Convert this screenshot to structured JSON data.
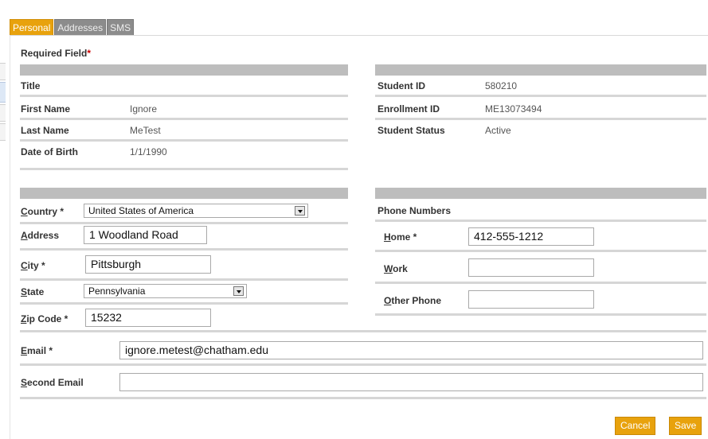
{
  "tabs": [
    "Personal",
    "Addresses",
    "SMS"
  ],
  "required_label": "Required Field",
  "required_star": "*",
  "personal": {
    "title_label": "Title",
    "title_value": "",
    "first_name_label": "First Name",
    "first_name_value": "Ignore",
    "last_name_label": "Last Name",
    "last_name_value": "MeTest",
    "dob_label": "Date of Birth",
    "dob_value": "1/1/1990"
  },
  "student": {
    "id_label": "Student ID",
    "id_value": "580210",
    "enrollment_label": "Enrollment ID",
    "enrollment_value": "ME13073494",
    "status_label": "Student Status",
    "status_value": "Active"
  },
  "address": {
    "country_label": "Country *",
    "country_value": "United States of America",
    "address_label": "Address",
    "address_value": "1 Woodland Road",
    "city_label": "City *",
    "city_value": "Pittsburgh",
    "state_label": "State",
    "state_value": "Pennsylvania",
    "zip_label": "Zip Code *",
    "zip_value": "15232"
  },
  "phones": {
    "heading": "Phone Numbers",
    "home_label": "Home *",
    "home_value": "412-555-1212",
    "work_label": "Work",
    "work_value": "",
    "other_label": "Other Phone",
    "other_value": ""
  },
  "email": {
    "email_label": "Email *",
    "email_value": "ignore.metest@chatham.edu",
    "second_label": "Second Email",
    "second_value": ""
  },
  "buttons": {
    "cancel": "Cancel",
    "save": "Save"
  },
  "colors": {
    "accent": "#e8a20d",
    "header_bar": "#bdbdbd",
    "separator": "#d6d6d6"
  }
}
